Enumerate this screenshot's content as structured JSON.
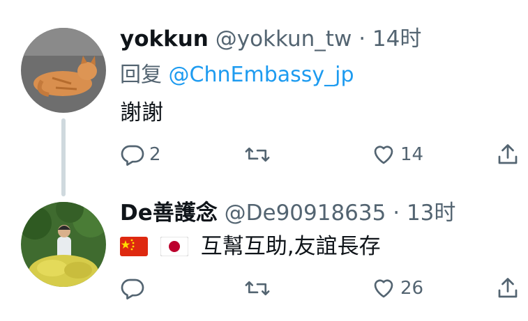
{
  "tweets": [
    {
      "name": "yokkun",
      "handle": "@yokkun_tw",
      "separator": "·",
      "time": "14时",
      "reply_prefix": "回复",
      "reply_mention": "@ChnEmbassy_jp",
      "text": "謝謝",
      "actions": {
        "reply_count": "2",
        "retweet_count": "",
        "like_count": "14"
      }
    },
    {
      "name": "De善護念",
      "handle": "@De90918635",
      "separator": "·",
      "time": "13时",
      "flags": [
        "china-flag-icon",
        "japan-flag-icon"
      ],
      "text": "互幫互助,友誼長存",
      "actions": {
        "reply_count": "",
        "retweet_count": "",
        "like_count": "26"
      }
    }
  ],
  "colors": {
    "accent": "#1d9bf0",
    "secondary_text": "#536471",
    "thread_line": "#cfd9de"
  }
}
